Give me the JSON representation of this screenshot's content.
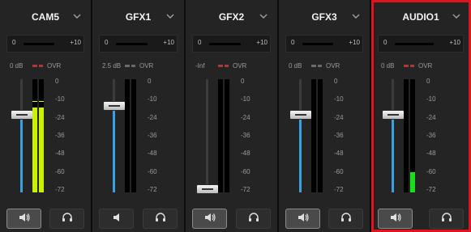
{
  "channels": [
    {
      "name": "CAM5",
      "trim": {
        "min": "0",
        "max": "+10"
      },
      "db": "0 dB",
      "ovr": "OVR",
      "ovr_color": "#a83a3a",
      "fader_level": 0.7,
      "meter_levels": [
        0.75,
        0.75
      ],
      "meter_color": "#c9f000",
      "peak_level": 0.8,
      "mute_active": true,
      "selected": false
    },
    {
      "name": "GFX1",
      "trim": {
        "min": "0",
        "max": "+10"
      },
      "db": "2.5 dB",
      "ovr": "OVR",
      "ovr_color": "#6a6a6a",
      "fader_level": 0.78,
      "meter_levels": [
        0,
        0
      ],
      "meter_color": "#c9f000",
      "mute_active": false,
      "selected": false
    },
    {
      "name": "GFX2",
      "trim": {
        "min": "0",
        "max": "+10"
      },
      "db": "-Inf",
      "ovr": "OVR",
      "ovr_color": "#a83a3a",
      "fader_level": 0.0,
      "meter_levels": [
        0,
        0
      ],
      "meter_color": "#c9f000",
      "mute_active": true,
      "selected": false
    },
    {
      "name": "GFX3",
      "trim": {
        "min": "0",
        "max": "+10"
      },
      "db": "0 dB",
      "ovr": "OVR",
      "ovr_color": "#6a6a6a",
      "fader_level": 0.7,
      "meter_levels": [
        0,
        0
      ],
      "meter_color": "#c9f000",
      "mute_active": true,
      "selected": false
    },
    {
      "name": "AUDIO1",
      "trim": {
        "min": "0",
        "max": "+10"
      },
      "db": "0 dB",
      "ovr": "OVR",
      "ovr_color": "#a83a3a",
      "fader_level": 0.7,
      "meter_levels": [
        0,
        0.18
      ],
      "meter_color": "#18e018",
      "mute_active": true,
      "selected": true
    }
  ],
  "scale_ticks": [
    "0",
    "-10",
    "-24",
    "-36",
    "-48",
    "-60",
    "-72"
  ],
  "icons": {
    "menu": "chevron-down-icon",
    "mute": "speaker-icon",
    "monitor": "headphones-icon"
  },
  "colors": {
    "fader_fill": "#3aa0e0",
    "selection": "#e0141b"
  }
}
